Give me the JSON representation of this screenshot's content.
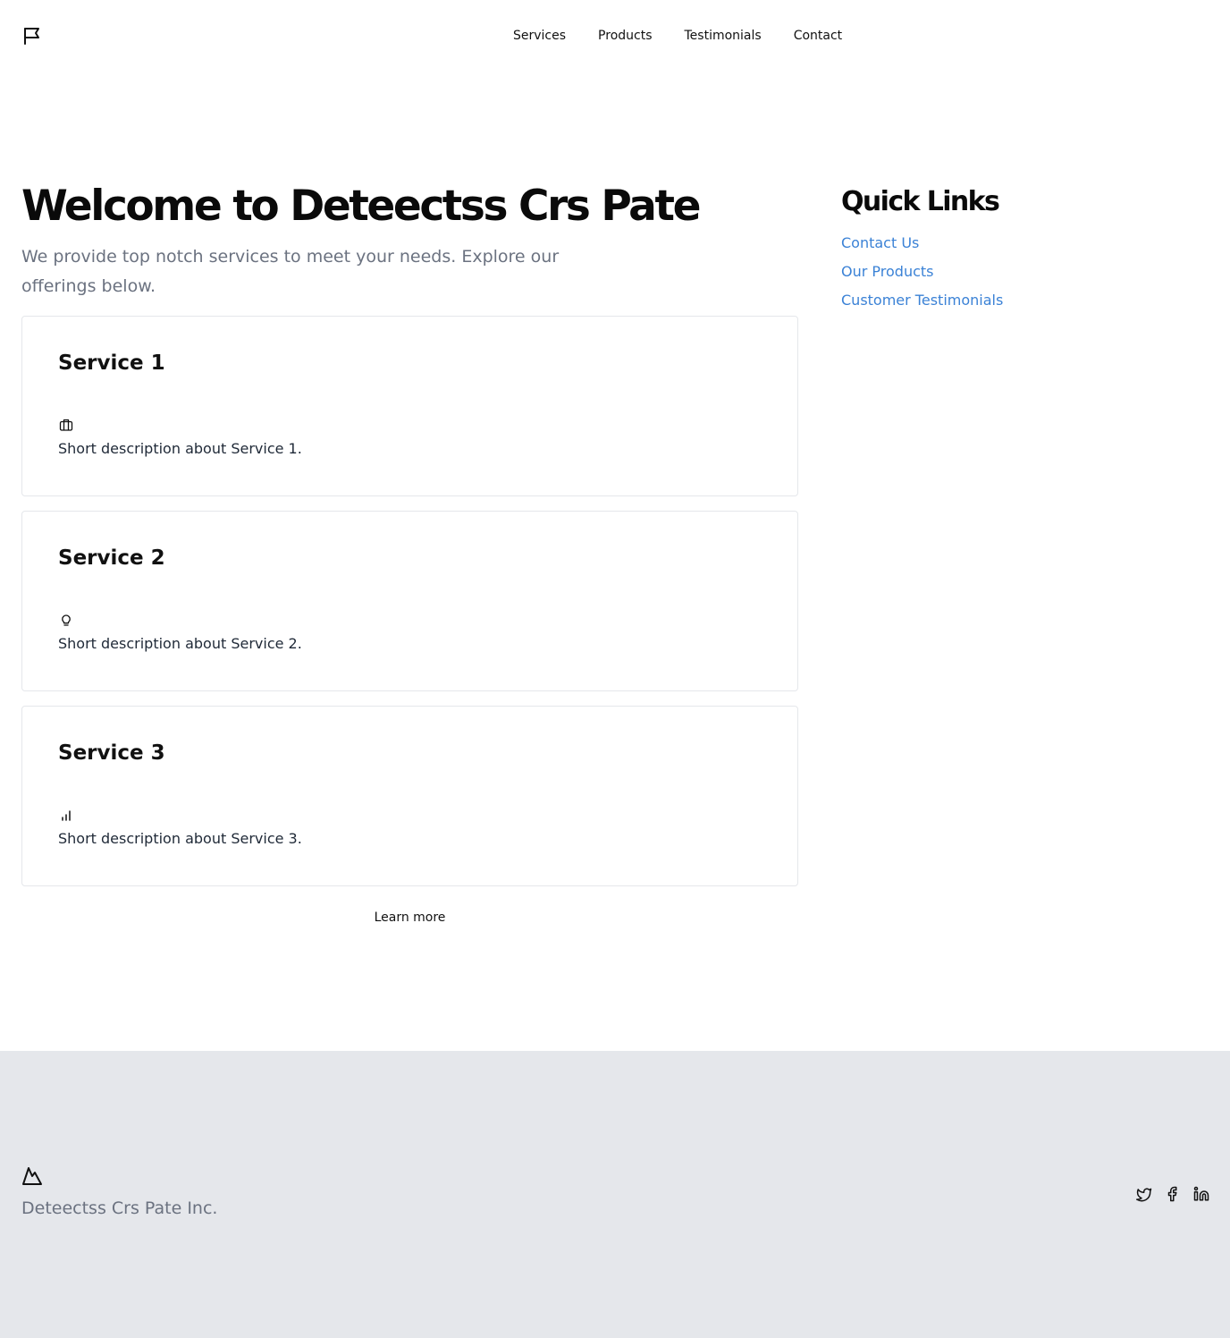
{
  "header": {
    "logo_icon": "flag-icon",
    "nav": [
      "Services",
      "Products",
      "Testimonials",
      "Contact"
    ]
  },
  "hero": {
    "title": "Welcome to Deteectss Crs Pate",
    "subtitle": "We provide top notch services to meet your needs. Explore our offerings below."
  },
  "services": [
    {
      "title": "Service 1",
      "icon": "briefcase-icon",
      "description": "Short description about Service 1."
    },
    {
      "title": "Service 2",
      "icon": "lightbulb-icon",
      "description": "Short description about Service 2."
    },
    {
      "title": "Service 3",
      "icon": "bar-chart-icon",
      "description": "Short description about Service 3."
    }
  ],
  "learn_more": "Learn more",
  "quick_links": {
    "title": "Quick Links",
    "items": [
      "Contact Us",
      "Our Products",
      "Customer Testimonials"
    ]
  },
  "footer": {
    "logo_icon": "mountain-icon",
    "company": "Deteectss Crs Pate Inc.",
    "social_icons": [
      "twitter-icon",
      "facebook-icon",
      "linkedin-icon"
    ]
  },
  "colors": {
    "link": "#3b82d6",
    "muted_text": "#6b7280",
    "footer_bg": "#e5e7eb",
    "card_border": "#e5e7eb"
  }
}
